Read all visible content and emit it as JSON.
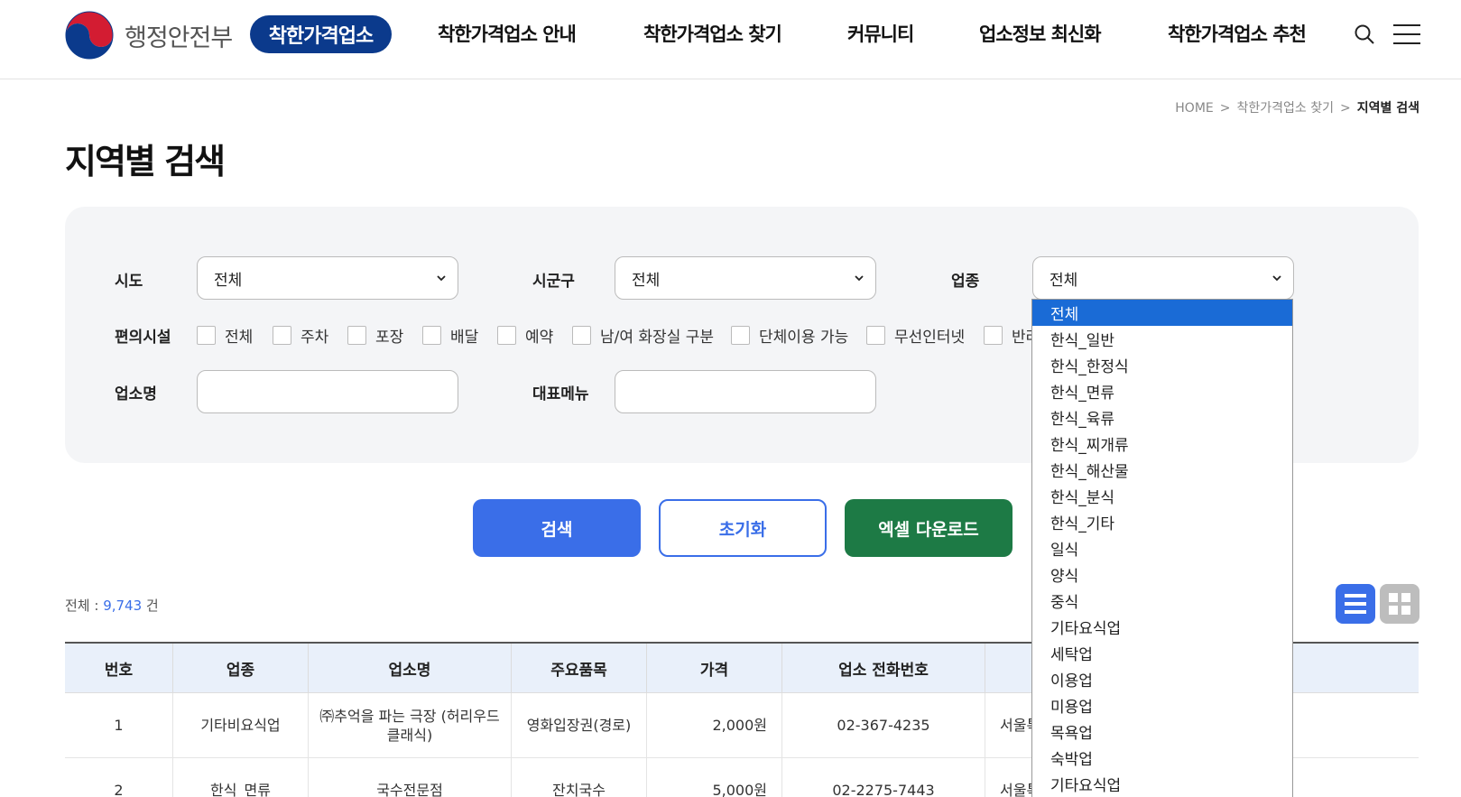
{
  "header": {
    "ministry": "행정안전부",
    "brand": "착한가격업소",
    "nav": [
      "착한가격업소 안내",
      "착한가격업소 찾기",
      "커뮤니티",
      "업소정보 최신화",
      "착한가격업소 추천"
    ],
    "icons": [
      "search-icon",
      "hamburger-menu-icon"
    ]
  },
  "breadcrumb": {
    "home": "HOME",
    "sep": ">",
    "parent": "착한가격업소 찾기",
    "current": "지역별 검색"
  },
  "page_title": "지역별 검색",
  "search": {
    "sido_label": "시도",
    "sido_value": "전체",
    "sigungu_label": "시군구",
    "sigungu_value": "전체",
    "category_label": "업종",
    "category_value": "전체",
    "amenities_label": "편의시설",
    "amenities": [
      "전체",
      "주차",
      "포장",
      "배달",
      "예약",
      "남/여 화장실 구분",
      "단체이용 가능",
      "무선인터넷",
      "반려"
    ],
    "name_label": "업소명",
    "menu_label": "대표메뉴"
  },
  "buttons": {
    "search": "검색",
    "reset": "초기화",
    "excel": "엑셀 다운로드"
  },
  "total": {
    "label": "전체 : ",
    "count": "9,743",
    "unit": " 건"
  },
  "table": {
    "headers": [
      "번호",
      "업종",
      "업소명",
      "주요품목",
      "가격",
      "업소 전화번호",
      ""
    ],
    "rows": [
      [
        "1",
        "기타비요식업",
        "㈜추억을 파는 극장 (허리우드클래식)",
        "영화입장권(경로)",
        "2,000원",
        "02-367-4235",
        "서울특"
      ],
      [
        "2",
        "한식_면류",
        "국수전문점",
        "잔치국수",
        "5,000원",
        "02-2275-7443",
        "서울특"
      ]
    ]
  },
  "dropdown": {
    "selected": "전체",
    "options": [
      "전체",
      "한식_일반",
      "한식_한정식",
      "한식_면류",
      "한식_육류",
      "한식_찌개류",
      "한식_해산물",
      "한식_분식",
      "한식_기타",
      "일식",
      "양식",
      "중식",
      "기타요식업",
      "세탁업",
      "이용업",
      "미용업",
      "목욕업",
      "숙박업",
      "기타요식업"
    ]
  },
  "colors": {
    "primary": "#3a6ee8",
    "excel": "#1d7a45",
    "brand_badge": "#0b3a8c",
    "dropdown_selected": "#1a6bd6"
  }
}
